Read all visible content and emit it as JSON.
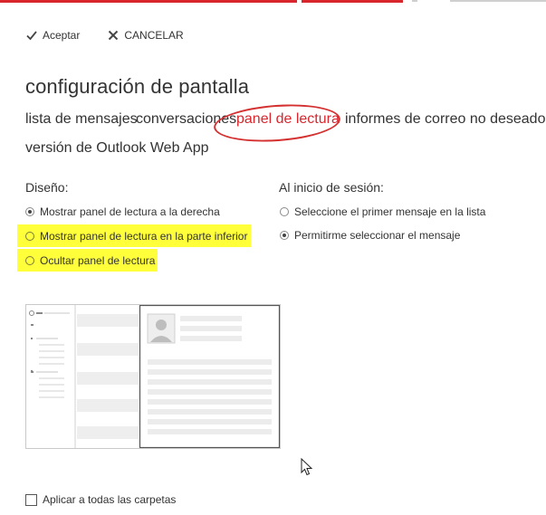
{
  "toolbar": {
    "accept_label": "Aceptar",
    "cancel_label": "CANCELAR"
  },
  "page": {
    "title": "configuración de pantalla"
  },
  "tabs": [
    {
      "label": "lista de mensajes",
      "active": false
    },
    {
      "label": "conversaciones",
      "active": false
    },
    {
      "label": "panel de lectura",
      "active": true
    },
    {
      "label": "informes de correo no deseado",
      "active": false
    },
    {
      "label": "versión de Outlook Web App",
      "active": false
    }
  ],
  "layout_section": {
    "label": "Diseño:",
    "options": [
      {
        "label": "Mostrar panel de lectura a la derecha",
        "checked": true,
        "highlighted": false
      },
      {
        "label": "Mostrar panel de lectura en la parte inferior",
        "checked": false,
        "highlighted": true
      },
      {
        "label": "Ocultar panel de lectura",
        "checked": false,
        "highlighted": true
      }
    ]
  },
  "signin_section": {
    "label": "Al inicio de sesión:",
    "options": [
      {
        "label": "Seleccione el primer mensaje en la lista",
        "checked": false
      },
      {
        "label": "Permitirme seleccionar el mensaje",
        "checked": true
      }
    ]
  },
  "apply_all": {
    "label": "Aplicar a todas las carpetas",
    "checked": false
  },
  "colors": {
    "accent": "#d9262c",
    "highlight": "#ffff3a",
    "annotation": "#d43030"
  },
  "icons": {
    "accept": "checkmark-icon",
    "cancel": "close-icon",
    "cursor": "mouse-pointer-icon"
  }
}
